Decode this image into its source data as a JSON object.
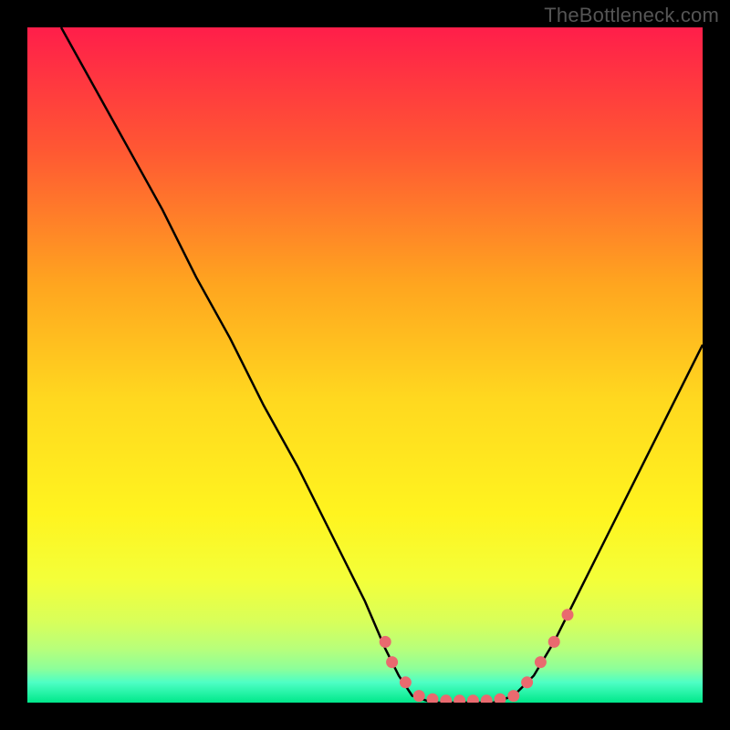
{
  "watermark": "TheBottleneck.com",
  "chart_data": {
    "type": "line",
    "title": "",
    "xlabel": "",
    "ylabel": "",
    "xlim": [
      0,
      100
    ],
    "ylim": [
      0,
      100
    ],
    "curve": [
      {
        "x": 5,
        "y": 100
      },
      {
        "x": 10,
        "y": 91
      },
      {
        "x": 15,
        "y": 82
      },
      {
        "x": 20,
        "y": 73
      },
      {
        "x": 25,
        "y": 63
      },
      {
        "x": 30,
        "y": 54
      },
      {
        "x": 35,
        "y": 44
      },
      {
        "x": 40,
        "y": 35
      },
      {
        "x": 45,
        "y": 25
      },
      {
        "x": 50,
        "y": 15
      },
      {
        "x": 53,
        "y": 8
      },
      {
        "x": 55,
        "y": 4
      },
      {
        "x": 57,
        "y": 1
      },
      {
        "x": 60,
        "y": 0
      },
      {
        "x": 63,
        "y": 0
      },
      {
        "x": 66,
        "y": 0
      },
      {
        "x": 69,
        "y": 0
      },
      {
        "x": 72,
        "y": 1
      },
      {
        "x": 75,
        "y": 4
      },
      {
        "x": 78,
        "y": 9
      },
      {
        "x": 82,
        "y": 17
      },
      {
        "x": 86,
        "y": 25
      },
      {
        "x": 90,
        "y": 33
      },
      {
        "x": 95,
        "y": 43
      },
      {
        "x": 100,
        "y": 53
      }
    ],
    "markers": [
      {
        "x": 53,
        "y": 9
      },
      {
        "x": 54,
        "y": 6
      },
      {
        "x": 56,
        "y": 3
      },
      {
        "x": 58,
        "y": 1
      },
      {
        "x": 60,
        "y": 0.5
      },
      {
        "x": 62,
        "y": 0.3
      },
      {
        "x": 64,
        "y": 0.3
      },
      {
        "x": 66,
        "y": 0.3
      },
      {
        "x": 68,
        "y": 0.3
      },
      {
        "x": 70,
        "y": 0.5
      },
      {
        "x": 72,
        "y": 1
      },
      {
        "x": 74,
        "y": 3
      },
      {
        "x": 76,
        "y": 6
      },
      {
        "x": 78,
        "y": 9
      },
      {
        "x": 80,
        "y": 13
      }
    ],
    "gradient_stops": [
      {
        "offset": 0,
        "color": "#ff1e4a"
      },
      {
        "offset": 18,
        "color": "#ff5733"
      },
      {
        "offset": 38,
        "color": "#ffa51f"
      },
      {
        "offset": 55,
        "color": "#ffd81f"
      },
      {
        "offset": 72,
        "color": "#fff41f"
      },
      {
        "offset": 82,
        "color": "#f3ff3a"
      },
      {
        "offset": 88,
        "color": "#d8ff5a"
      },
      {
        "offset": 92,
        "color": "#b8ff7a"
      },
      {
        "offset": 95,
        "color": "#8cff9a"
      },
      {
        "offset": 97,
        "color": "#4effc5"
      },
      {
        "offset": 100,
        "color": "#00e88a"
      }
    ]
  }
}
